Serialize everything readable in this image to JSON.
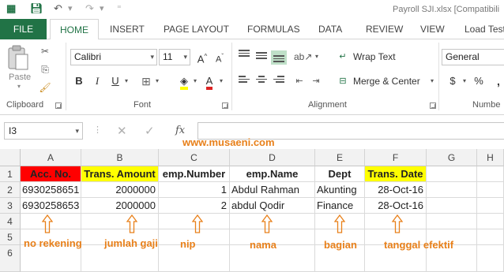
{
  "title": "Payroll SJI.xlsx  [Compatibili",
  "tabs": [
    "FILE",
    "HOME",
    "INSERT",
    "PAGE LAYOUT",
    "FORMULAS",
    "DATA",
    "REVIEW",
    "VIEW",
    "Load Test"
  ],
  "ribbon": {
    "paste_label": "Paste",
    "clipboard_label": "Clipboard",
    "font_label": "Font",
    "alignment_label": "Alignment",
    "number_label": "Numbe",
    "font_name": "Calibri",
    "font_size": "11",
    "bold": "B",
    "italic": "I",
    "underline": "U",
    "wrap_text": "Wrap Text",
    "merge_center": "Merge & Center",
    "number_format": "General"
  },
  "formula_bar": {
    "name_box": "I3",
    "fx": "fx",
    "formula": ""
  },
  "watermark": "www.musaeni.com",
  "columns": [
    "A",
    "B",
    "C",
    "D",
    "E",
    "F",
    "G",
    "H"
  ],
  "rows": [
    "1",
    "2",
    "3",
    "4",
    "5",
    "6"
  ],
  "sheet": {
    "header": [
      "Acc. No.",
      "Trans. Amount",
      "emp.Number",
      "emp.Name",
      "Dept",
      "Trans. Date"
    ],
    "data": [
      [
        "6930258651",
        "2000000",
        "1",
        "Abdul Rahman",
        "Akunting",
        "28-Oct-16"
      ],
      [
        "6930258653",
        "2000000",
        "2",
        "abdul Qodir",
        "Finance",
        "28-Oct-16"
      ]
    ]
  },
  "annotations": [
    "no rekening",
    "jumlah gaji",
    "nip",
    "nama",
    "bagian",
    "tanggal efektif"
  ],
  "colors": {
    "accent": "#217346",
    "annotation": "#e8801a",
    "red_fill": "#ff0000",
    "yellow_fill": "#ffff00"
  }
}
